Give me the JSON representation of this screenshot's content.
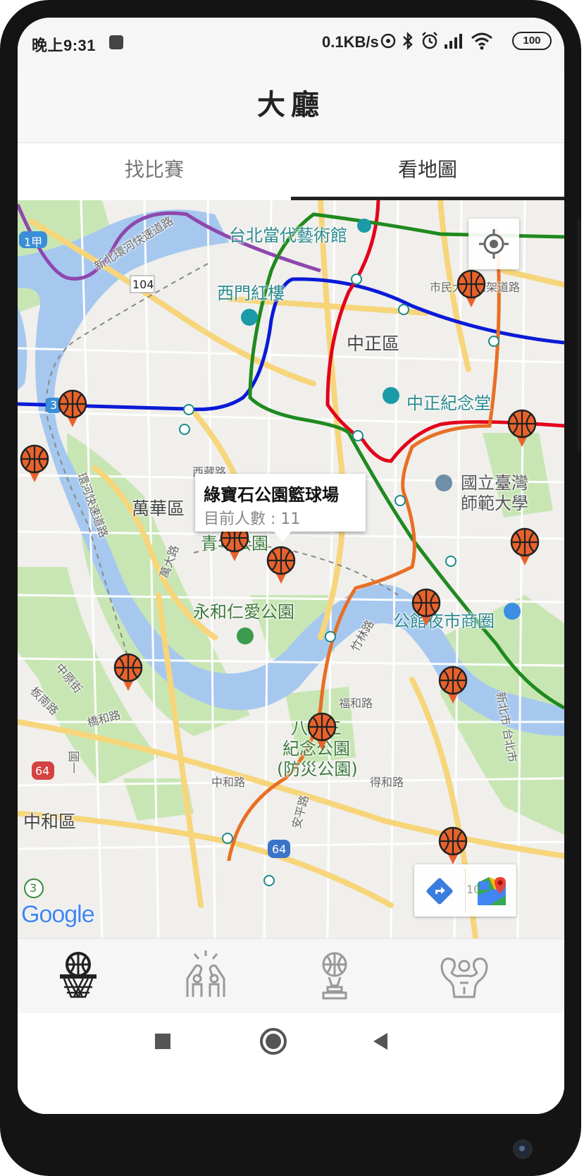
{
  "status_bar": {
    "time": "晚上9:31",
    "network_speed": "0.1KB/s",
    "battery": "100"
  },
  "header": {
    "title": "大廳"
  },
  "tabs": [
    {
      "label": "找比賽",
      "active": false
    },
    {
      "label": "看地圖",
      "active": true
    }
  ],
  "map": {
    "labels": {
      "arts": "台北當代藝術館",
      "ximen": "西門紅樓",
      "zhongzheng_district": "中正區",
      "cks_memorial": "中正紀念堂",
      "ntnu_1": "國立臺灣",
      "ntnu_2": "師範大學",
      "wanhua": "萬華區",
      "qingnian_park": "青年公園",
      "yonghe_park": "永和仁愛公園",
      "gongguan": "公館夜市商圈",
      "memorial_park_1": "八二三",
      "memorial_park_2": "紀念公園",
      "memorial_park_3": "(防災公園)",
      "zhonghe": "中和區",
      "shimin": "市民大道高架道路",
      "xibei": "新北環河快速道路",
      "huanhe": "環河快速道路",
      "xizang": "西藏路",
      "wanda": "萬大路",
      "zhuzi": "竹林路",
      "fuhe": "福和路",
      "zhongyuan": "中原街",
      "banlan": "板南路",
      "qiaohe": "橋和路",
      "zhonghe_rd": "中和路",
      "anping": "安平路",
      "dehe": "得和路",
      "taipei_city": "新北市 台北市",
      "shengyi": "國一",
      "road_104": "104",
      "road_1jia": "1甲",
      "road_3": "3",
      "road_64a": "64",
      "road_64b": "64",
      "road_3b": "3"
    },
    "info_window": {
      "title": "綠寶石公園籃球場",
      "count_text": "目前人數 : 11"
    },
    "google_logo": "Google",
    "toolbar_fragment": "10",
    "colors": {
      "hoop_orange": "#e8622c",
      "mrt_red": "#e3002c",
      "mrt_green": "#008659",
      "mrt_blue": "#0070bd",
      "mrt_orange": "#f8b61c",
      "mrt_purple": "#8e47ad"
    }
  },
  "bottom_nav": [
    {
      "icon": "basketball-hoop-icon",
      "active": true
    },
    {
      "icon": "high-five-icon",
      "active": false
    },
    {
      "icon": "trophy-icon",
      "active": false
    },
    {
      "icon": "muscle-icon",
      "active": false
    }
  ],
  "system_nav": [
    "recent-apps",
    "home",
    "back"
  ]
}
